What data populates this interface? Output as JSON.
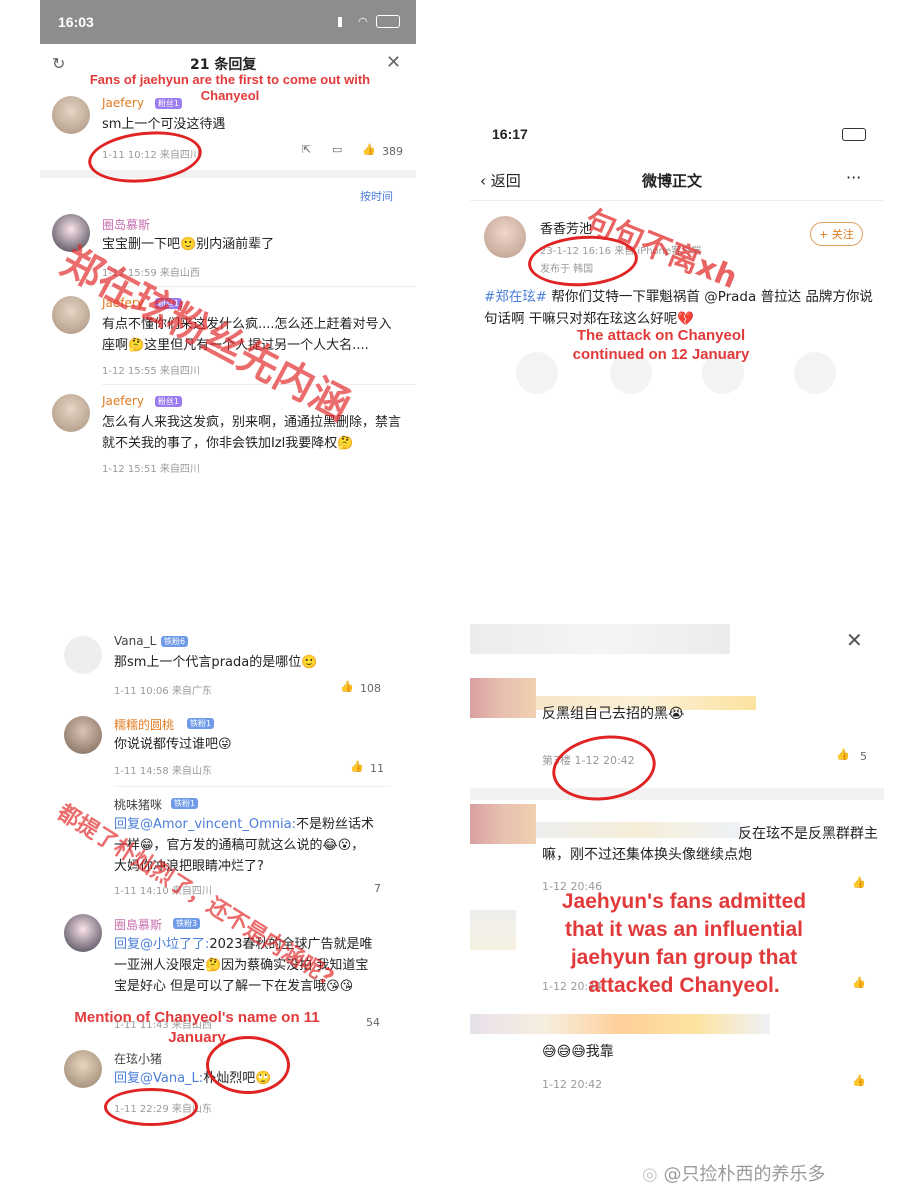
{
  "colors": {
    "accent_red": "#e23a3a",
    "link_blue": "#4a7ed9",
    "username_orange": "#e07a1f"
  },
  "p1": {
    "time": "16:03",
    "title": "21 条回复",
    "annot": "Fans of jaehyun are the first to come out with Chanyeol",
    "overlay_cn": "郑在玹粉丝先内涵",
    "sort": "按时间",
    "c1": {
      "name": "Jaefery",
      "badge": "粉丝1",
      "text": "sm上一个可没这待遇",
      "meta": "1-11 10:12  来自四川",
      "likes": "389"
    },
    "c2": {
      "name": "圈岛慕斯",
      "text": "宝宝删一下吧🙂别内涵前辈了",
      "meta": "1-12 15:59  来自山西"
    },
    "c3": {
      "name": "Jaefery",
      "badge": "粉丝1",
      "text": "有点不懂你们来这发什么疯....怎么还上赶着对号入座啊🤔这里但凡有一个人提过另一个人大名....",
      "meta": "1-12 15:55  来自四川"
    },
    "c4": {
      "name": "Jaefery",
      "badge": "粉丝1",
      "text": "怎么有人来我这发疯，别来啊，通通拉黑删除，禁言就不关我的事了，你非会铁加Izl我要降权🤔",
      "meta": "1-12 15:51  来自四川"
    }
  },
  "p2": {
    "time": "16:17",
    "back": "返回",
    "title": "微博正文",
    "more": "···",
    "user": "香香芳池",
    "follow": "+ 关注",
    "meta": "23-1-12 16:16  来自 iPhone客户端",
    "meta2": "发布于 韩国",
    "post_tag": "#郑在玹#",
    "post": " 帮你们艾特一下罪魁祸首 @Prada 普拉达 品牌方你说句话啊 干嘛只对郑在玹这么好呢💔",
    "annot": "The attack on Chanyeol continued on 12 January",
    "overlay_cn": "句句不离xh"
  },
  "p3": {
    "c1": {
      "name": "Vana_L",
      "badge": "铁粉6",
      "text": "那sm上一个代言prada的是哪位🙂",
      "meta": "1-11 10:06  来自广东",
      "likes": "108"
    },
    "c2": {
      "name": "糯糯的圆桃",
      "badge": "铁粉1",
      "text": "你说说都传过谁吧😜",
      "meta": "1-11 14:58  来自山东",
      "likes": "11"
    },
    "c3": {
      "name": "桃味猪咪",
      "badge": "铁粉1",
      "reply": "回复@Amor_vincent_Omnia:",
      "text": "不是粉丝话术一样😁，官方发的通稿可就这么说的😂😮，大妈你冲浪把眼睛冲烂了?",
      "meta": "1-11 14:10  来自四川",
      "likes": "7"
    },
    "c4": {
      "name": "圈島慕斯",
      "badge": "铁粉3",
      "reply": "回复@小垃了了:",
      "text": "2023春秋的全球广告就是唯一亚洲人没限定🤔因为蔡确实没拍 我知道宝宝是好心 但是可以了解一下在发言哦😘😘",
      "meta": "1-11 11:43  来自山西",
      "likes": "54"
    },
    "c5": {
      "name": "在玹小猪",
      "reply": "回复@Vana_L:",
      "text": "朴灿烈吧🙄",
      "meta": "1-11 22:29  来自山东"
    },
    "annot": "Mention of Chanyeol's name on 11 January",
    "overlay_cn": "都提了朴灿烈了，还不是内涵呢?"
  },
  "p4": {
    "c1": {
      "text": "反黑组自己去招的黑😭",
      "meta": "第3楼  1-12 20:42",
      "likes": "5"
    },
    "c2": {
      "text": "反在玹不是反黑群群主嘛，刚不过还集体换头像继续点炮",
      "meta": "1-12 20:46"
    },
    "c3": {
      "meta": "1-12 20:44"
    },
    "c4": {
      "text": "😅😅😅我靠",
      "meta": "1-12 20:42"
    },
    "annot": "Jaehyun's fans admitted that it was an influential jaehyun fan group that attacked Chanyeol."
  },
  "watermark": "@只捡朴西的养乐多",
  "watermark_small": "@只捡朴西的养乐多"
}
